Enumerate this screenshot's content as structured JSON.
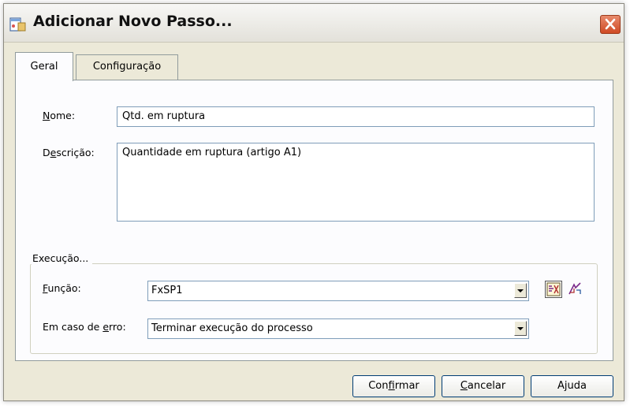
{
  "window": {
    "title": "Adicionar Novo Passo...",
    "close_icon": "close-icon"
  },
  "tabs": [
    {
      "label": "Geral",
      "active": true
    },
    {
      "label": "Configuração",
      "active": false
    }
  ],
  "general": {
    "name_label_first": "N",
    "name_label_rest": "ome:",
    "name_value": "Qtd. em ruptura",
    "desc_label_pre": "D",
    "desc_label_ul": "e",
    "desc_label_post": "scrição:",
    "desc_value": "Quantidade em ruptura (artigo A1)"
  },
  "execution": {
    "group_label": "Execução...",
    "function_label_ul": "F",
    "function_label_rest": "unção:",
    "function_value": "FxSP1",
    "error_label_pre": "Em caso de ",
    "error_label_ul": "e",
    "error_label_post": "rro:",
    "error_value": "Terminar execução do processo",
    "tool_icons": [
      "function-editor-icon",
      "function-wizard-icon"
    ]
  },
  "buttons": {
    "confirm_pre": "Con",
    "confirm_ul": "f",
    "confirm_post": "irmar",
    "cancel_ul": "C",
    "cancel_post": "ancelar",
    "help_pre": "A",
    "help_ul": "j",
    "help_post": "uda"
  },
  "colors": {
    "dialog_bg": "#ece9d8",
    "panel_bg": "#fcfcfe",
    "input_border": "#7f9db9",
    "close_button": "#cf4a24"
  }
}
